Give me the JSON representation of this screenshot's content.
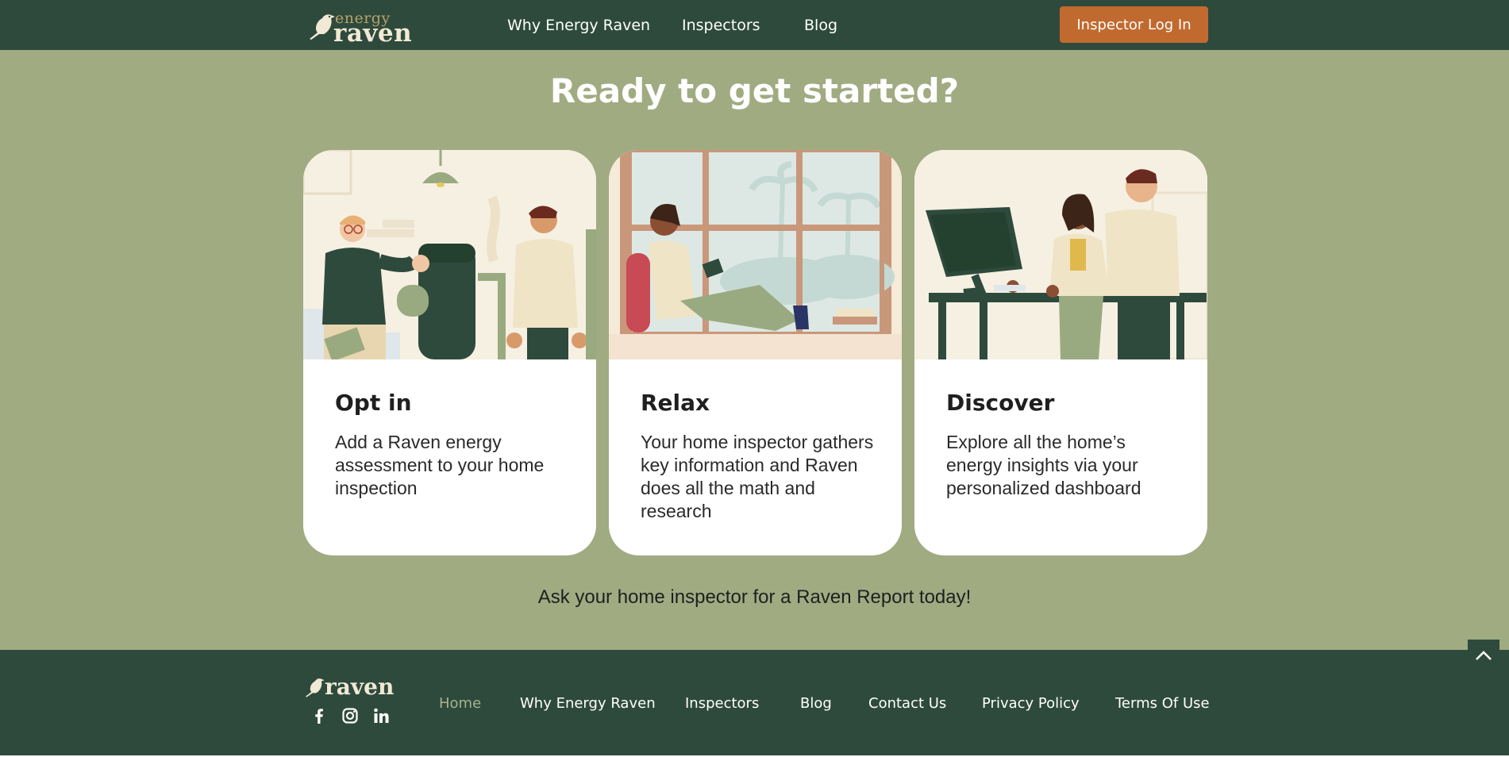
{
  "header": {
    "logo_top": "energy",
    "logo_main": "raven",
    "nav": [
      "Why Energy Raven",
      "Inspectors",
      "Blog"
    ],
    "login_label": "Inspector Log In"
  },
  "main": {
    "heading": "Ready to get started?",
    "cards": [
      {
        "title": "Opt in",
        "desc": "Add a Raven energy assessment to your home inspection"
      },
      {
        "title": "Relax",
        "desc": "Your home inspector gathers key information and Raven does all the math and research"
      },
      {
        "title": "Discover",
        "desc": "Explore all the home’s energy insights via your personalized dashboard"
      }
    ],
    "cta": "Ask your home inspector for a Raven Report today!"
  },
  "footer": {
    "logo": "raven",
    "social_icons": [
      "facebook-icon",
      "instagram-icon",
      "linkedin-icon"
    ],
    "nav": [
      "Home",
      "Why Energy Raven",
      "Inspectors",
      "Blog",
      "Contact Us",
      "Privacy Policy",
      "Terms Of Use"
    ],
    "active_index": 0
  },
  "colors": {
    "header_bg": "#2e4a3c",
    "page_bg": "#a0ab82",
    "accent_button": "#c16a2f",
    "footer_active": "#a6b38e"
  }
}
